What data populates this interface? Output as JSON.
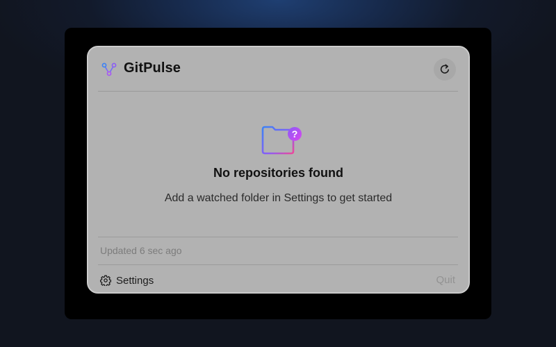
{
  "app": {
    "title": "GitPulse",
    "icon": "git-network-icon",
    "accent_gradient": [
      "#3b82f6",
      "#a855f7",
      "#ec4899"
    ]
  },
  "header": {
    "refresh_icon": "refresh-icon"
  },
  "empty_state": {
    "icon": "folder-question-icon",
    "title": "No repositories found",
    "subtitle": "Add a watched folder in Settings to get started"
  },
  "status": {
    "updated_text": "Updated 6 sec ago"
  },
  "footer": {
    "settings_label": "Settings",
    "settings_icon": "gear-icon",
    "quit_label": "Quit"
  }
}
